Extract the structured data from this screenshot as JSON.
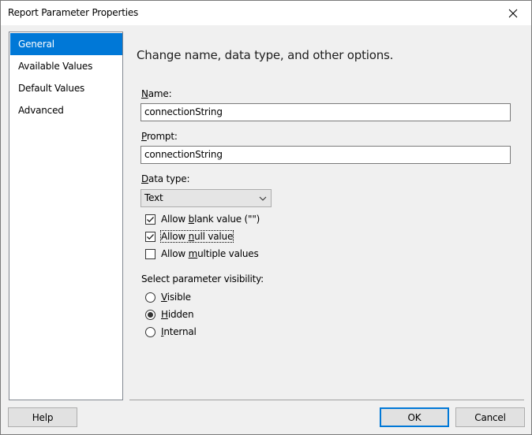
{
  "window": {
    "title": "Report Parameter Properties"
  },
  "nav": {
    "items": [
      {
        "label": "General"
      },
      {
        "label": "Available Values"
      },
      {
        "label": "Default Values"
      },
      {
        "label": "Advanced"
      }
    ]
  },
  "main": {
    "heading": "Change name, data type, and other options.",
    "name": {
      "label_key": "N",
      "label_rest": "ame:",
      "value": "connectionString"
    },
    "prompt": {
      "label_key": "P",
      "label_rest": "rompt:",
      "value": "connectionString"
    },
    "data_type": {
      "label_key": "D",
      "label_rest": "ata type:",
      "value": "Text"
    },
    "checkboxes": {
      "allow_blank": {
        "pre": "Allow ",
        "key": "b",
        "post": "lank value (\"\")",
        "checked": true
      },
      "allow_null": {
        "pre": "Allow ",
        "key": "n",
        "post": "ull value",
        "checked": true
      },
      "allow_multiple": {
        "pre": "Allow ",
        "key": "m",
        "post": "ultiple values",
        "checked": false
      }
    },
    "visibility": {
      "label": "Select parameter visibility:",
      "options": [
        {
          "key": "V",
          "rest": "isible",
          "selected": false
        },
        {
          "key": "H",
          "rest": "idden",
          "selected": true
        },
        {
          "key": "I",
          "rest": "nternal",
          "selected": false
        }
      ]
    }
  },
  "footer": {
    "help_label": "Help",
    "ok_label": "OK",
    "cancel_label": "Cancel"
  },
  "colors": {
    "selection": "#0078d7",
    "window_bg": "#f0f0f0"
  }
}
